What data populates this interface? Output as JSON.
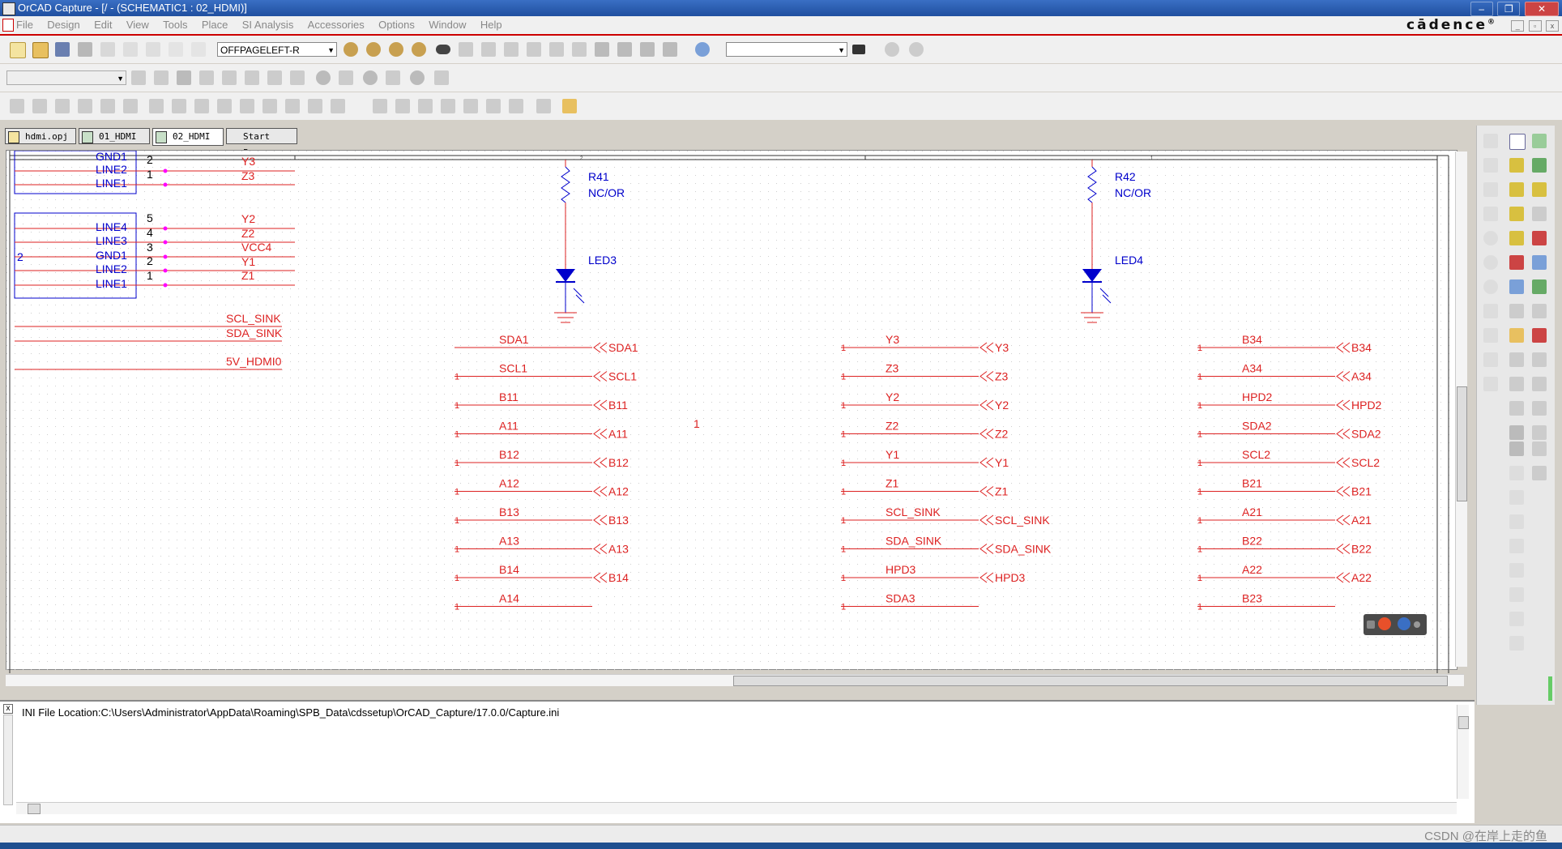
{
  "window": {
    "title": "OrCAD Capture - [/ - (SCHEMATIC1 : 02_HDMI)]"
  },
  "menubar": {
    "items": [
      "File",
      "Design",
      "Edit",
      "View",
      "Tools",
      "Place",
      "SI Analysis",
      "Accessories",
      "Options",
      "Window",
      "Help"
    ],
    "brand": "cādence",
    "brand_mark": "®"
  },
  "toolbar": {
    "offpage_value": "OFFPAGELEFT-R",
    "search_value": ""
  },
  "tabs": [
    {
      "label": "hdmi.opj"
    },
    {
      "label": "01_HDMI"
    },
    {
      "label": "02_HDMI"
    },
    {
      "label": "Start Page"
    }
  ],
  "schematic": {
    "colors": {
      "wire": "#dd2222",
      "part": "#0000cc",
      "pin_dot": "#ff00ff",
      "grid": "#cfcfcf",
      "border": "#333333"
    },
    "border_zones": [
      "2",
      "1"
    ],
    "conn_block1": {
      "pin_names": [
        "GND1",
        "LINE2",
        "LINE1"
      ],
      "pin_numbers": [
        "2",
        "1"
      ],
      "nets": [
        "Y3",
        "Z3"
      ]
    },
    "conn_block2": {
      "ref": "2",
      "pin_names": [
        "LINE4",
        "LINE3",
        "GND1",
        "LINE2",
        "LINE1"
      ],
      "pin_numbers": [
        "5",
        "4",
        "3",
        "2",
        "1"
      ],
      "nets": [
        "Y2",
        "Z2",
        "VCC4",
        "Y1",
        "Z1"
      ]
    },
    "left_nets": [
      "SCL_SINK",
      "SDA_SINK",
      "5V_HDMI0"
    ],
    "resistors": [
      {
        "ref": "R41",
        "value": "NC/OR"
      },
      {
        "ref": "R42",
        "value": "NC/OR"
      }
    ],
    "leds": [
      {
        "ref": "LED3"
      },
      {
        "ref": "LED4"
      }
    ],
    "stray_pin": "1",
    "pin_one": "1",
    "col1": [
      {
        "net": "SDA1",
        "port": "SDA1"
      },
      {
        "net": "SCL1",
        "port": "SCL1"
      },
      {
        "net": "B11",
        "port": "B11"
      },
      {
        "net": "A11",
        "port": "A11"
      },
      {
        "net": "B12",
        "port": "B12"
      },
      {
        "net": "A12",
        "port": "A12"
      },
      {
        "net": "B13",
        "port": "B13"
      },
      {
        "net": "A13",
        "port": "A13"
      },
      {
        "net": "B14",
        "port": "B14"
      },
      {
        "net": "A14",
        "port": ""
      }
    ],
    "col2": [
      {
        "net": "Y3",
        "port": "Y3"
      },
      {
        "net": "Z3",
        "port": "Z3"
      },
      {
        "net": "Y2",
        "port": "Y2"
      },
      {
        "net": "Z2",
        "port": "Z2"
      },
      {
        "net": "Y1",
        "port": "Y1"
      },
      {
        "net": "Z1",
        "port": "Z1"
      },
      {
        "net": "SCL_SINK",
        "port": "SCL_SINK"
      },
      {
        "net": "SDA_SINK",
        "port": "SDA_SINK"
      },
      {
        "net": "HPD3",
        "port": "HPD3"
      },
      {
        "net": "SDA3",
        "port": ""
      }
    ],
    "col3": [
      {
        "net": "B34",
        "port": "B34"
      },
      {
        "net": "A34",
        "port": "A34"
      },
      {
        "net": "HPD2",
        "port": "HPD2"
      },
      {
        "net": "SDA2",
        "port": "SDA2"
      },
      {
        "net": "SCL2",
        "port": "SCL2"
      },
      {
        "net": "B21",
        "port": "B21"
      },
      {
        "net": "A21",
        "port": "A21"
      },
      {
        "net": "B22",
        "port": "B22"
      },
      {
        "net": "A22",
        "port": "A22"
      },
      {
        "net": "B23",
        "port": ""
      }
    ]
  },
  "session_log": {
    "text": "INI File Location:C:\\Users\\Administrator\\AppData\\Roaming\\SPB_Data\\cdssetup\\OrCAD_Capture/17.0.0/Capture.ini"
  },
  "status": {
    "watermark": "CSDN @在岸上走的鱼"
  }
}
